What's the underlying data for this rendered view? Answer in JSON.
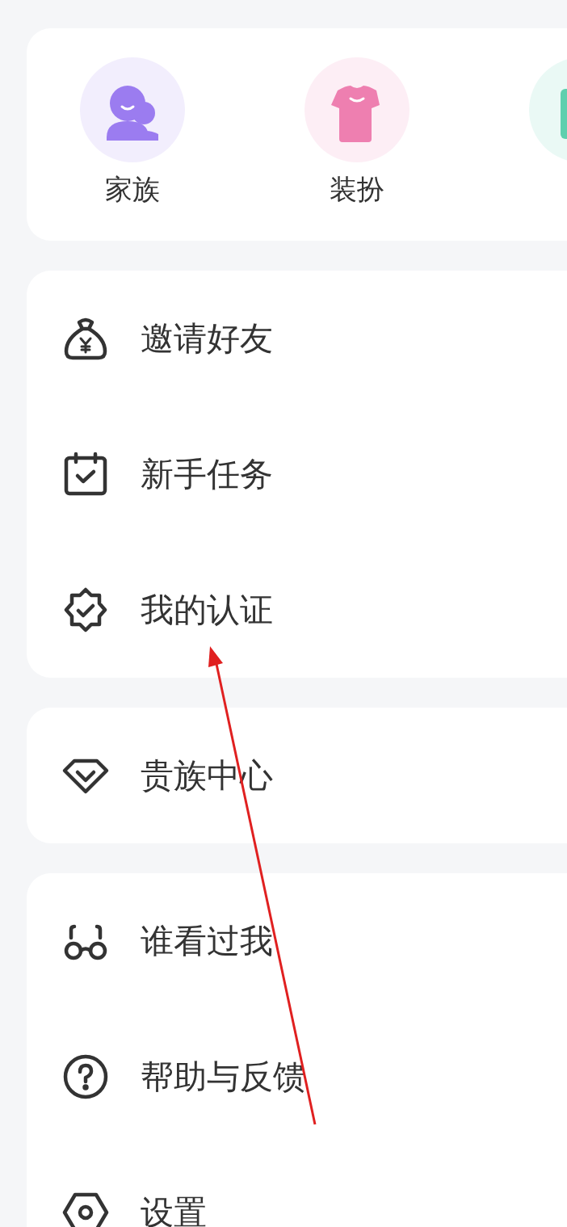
{
  "quick_items": [
    {
      "kind": "family",
      "label": "家族",
      "color": "#9b7cf0"
    },
    {
      "kind": "dress",
      "label": "装扮",
      "color": "#ee7fb0"
    },
    {
      "kind": "box",
      "color": "#5fcfae"
    }
  ],
  "menu_groups": [
    {
      "items": [
        {
          "label": "邀请好友"
        },
        {
          "label": "新手任务"
        },
        {
          "label": "我的认证"
        }
      ]
    },
    {
      "items": [
        {
          "label": "贵族中心"
        }
      ]
    },
    {
      "items": [
        {
          "label": "谁看过我"
        },
        {
          "label": "帮助与反馈"
        },
        {
          "label": "设置"
        }
      ]
    }
  ]
}
